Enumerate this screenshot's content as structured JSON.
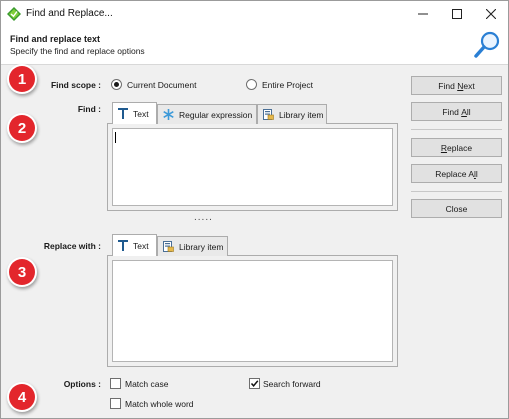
{
  "window": {
    "title": "Find and Replace...",
    "controls": {
      "minimize": "minimize-icon",
      "maximize": "maximize-icon",
      "close": "close-icon"
    }
  },
  "header": {
    "title": "Find and replace text",
    "subtitle": "Specify the find and replace options",
    "icon": "magnifier-icon"
  },
  "badges": [
    "1",
    "2",
    "3",
    "4"
  ],
  "find_scope": {
    "label": "Find scope :",
    "options": [
      {
        "label": "Current Document",
        "selected": true
      },
      {
        "label": "Entire Project",
        "selected": false
      }
    ]
  },
  "find": {
    "label": "Find :",
    "tabs": [
      {
        "label": "Text",
        "icon": "text-t-icon",
        "active": true
      },
      {
        "label": "Regular expression",
        "icon": "asterisk-icon",
        "active": false
      },
      {
        "label": "Library item",
        "icon": "library-item-icon",
        "active": false
      }
    ],
    "value": ""
  },
  "splitter": ".....",
  "replace": {
    "label": "Replace with :",
    "tabs": [
      {
        "label": "Text",
        "icon": "text-t-icon",
        "active": true
      },
      {
        "label": "Library item",
        "icon": "library-item-icon",
        "active": false
      }
    ],
    "value": ""
  },
  "options": {
    "label": "Options :",
    "match_case": {
      "label": "Match case",
      "checked": false
    },
    "search_forward": {
      "label": "Search forward",
      "checked": true
    },
    "match_whole_word": {
      "label": "Match whole word",
      "checked": false
    }
  },
  "buttons": {
    "find_next": {
      "pre": "Find ",
      "accel": "N",
      "post": "ext"
    },
    "find_all": {
      "pre": "Find ",
      "accel": "A",
      "post": "ll"
    },
    "replace": {
      "pre": "",
      "accel": "R",
      "post": "eplace"
    },
    "replace_all": {
      "pre": "Replace A",
      "accel": "l",
      "post": "l"
    },
    "close": {
      "pre": "",
      "accel": "",
      "post": "Close"
    }
  },
  "colors": {
    "badge": "#e3262c",
    "app_icon": "#3a9a2e",
    "magnifier": "#2a7fd4"
  }
}
